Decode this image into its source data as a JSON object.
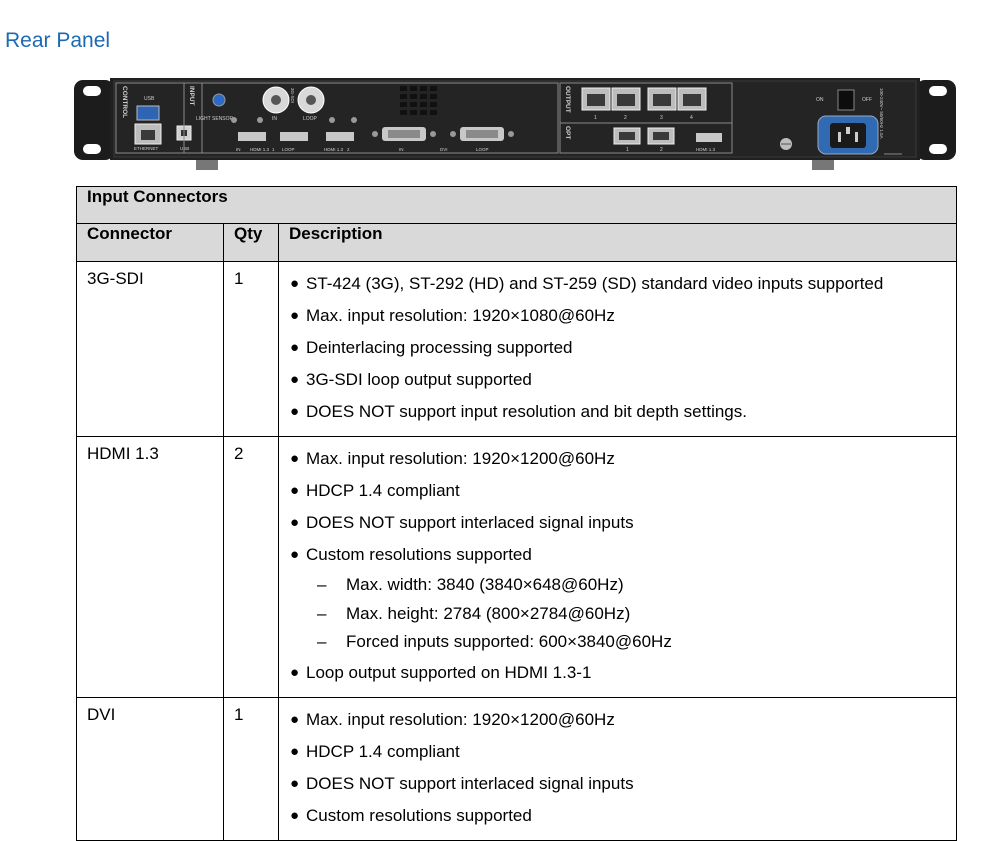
{
  "heading": "Rear Panel",
  "panel": {
    "control_label": "CONTROL",
    "usb_label": "USB",
    "ethernet_label": "ETHERNET",
    "usb_b_label": "USB",
    "input_label": "INPUT",
    "light_sensor_label": "LIGHT SENSOR",
    "sdi_label": "3G-SDI",
    "sdi_in_label": "IN",
    "sdi_loop_label": "LOOP",
    "hdmi_in_label": "IN",
    "hdmi_1_label": "HDMI 1.3",
    "hdmi_1_num": "1",
    "hdmi_loop_label": "LOOP",
    "hdmi_2_label": "HDMI 1.3",
    "hdmi_2_num": "2",
    "dvi_in_label": "IN",
    "dvi_label": "DVI",
    "dvi_loop_label": "LOOP",
    "output_label": "OUTPUT",
    "port_nums": [
      "1",
      "2",
      "3",
      "4"
    ],
    "opt_label": "OPT",
    "opt_nums": [
      "1",
      "2"
    ],
    "hdmi_out_label": "HDMI 1.3",
    "on_label": "ON",
    "off_label": "OFF",
    "power_rating": "100-240V~ 50/60Hz 1.5A"
  },
  "table": {
    "section_title": "Input Connectors",
    "headers": {
      "connector": "Connector",
      "qty": "Qty",
      "description": "Description"
    },
    "bullet": "●",
    "dash": "–",
    "rows": [
      {
        "connector": "3G-SDI",
        "qty": "1",
        "items": [
          {
            "text": "ST-424 (3G), ST-292 (HD) and ST-259 (SD) standard video inputs supported"
          },
          {
            "text": "Max. input resolution: 1920×1080@60Hz"
          },
          {
            "text": "Deinterlacing processing supported"
          },
          {
            "text": "3G-SDI loop output supported"
          },
          {
            "text": "DOES NOT support input resolution and bit depth settings."
          }
        ]
      },
      {
        "connector": "HDMI 1.3",
        "qty": "2",
        "items": [
          {
            "text": "Max. input resolution: 1920×1200@60Hz"
          },
          {
            "text": "HDCP 1.4 compliant"
          },
          {
            "text": "DOES NOT support interlaced signal inputs"
          },
          {
            "text": "Custom resolutions supported"
          },
          {
            "text": "Max. width: 3840 (3840×648@60Hz)"
          },
          {
            "text": "Max. height: 2784 (800×2784@60Hz)"
          },
          {
            "text": "Forced inputs supported: 600×3840@60Hz"
          },
          {
            "text": "Loop output supported on HDMI 1.3-1"
          }
        ]
      },
      {
        "connector": "DVI",
        "qty": "1",
        "items": [
          {
            "text": "Max. input resolution: 1920×1200@60Hz"
          },
          {
            "text": "HDCP 1.4 compliant"
          },
          {
            "text": "DOES NOT support interlaced signal inputs"
          },
          {
            "text": "Custom resolutions supported"
          }
        ]
      }
    ]
  }
}
